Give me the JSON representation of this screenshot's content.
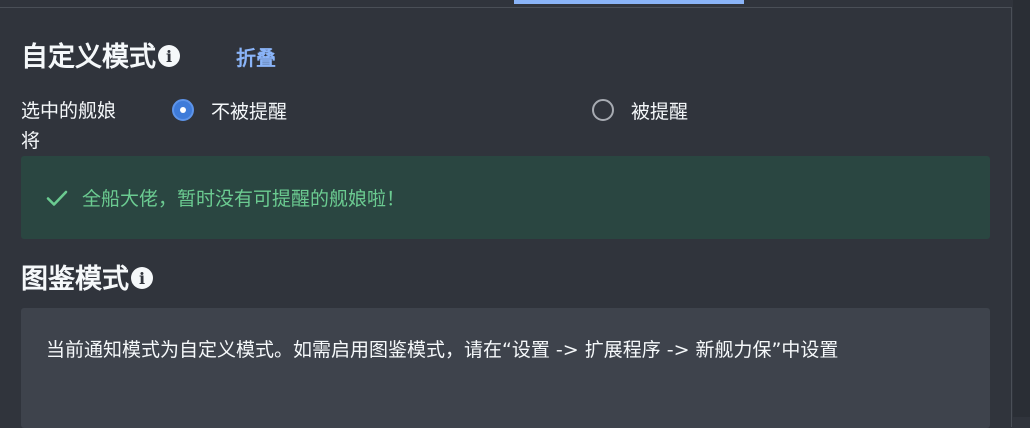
{
  "custom_mode": {
    "title": "自定义模式",
    "info_icon": "info-icon",
    "collapse_label": "折叠"
  },
  "selected_field": {
    "label": "选中的舰娘将",
    "options": [
      {
        "label": "不被提醒",
        "checked": true
      },
      {
        "label": "被提醒",
        "checked": false
      }
    ]
  },
  "success_callout": {
    "icon": "check-icon",
    "text": "全船大佬，暂时没有可提醒的舰娘啦！",
    "color": "#6bcb91"
  },
  "book_mode": {
    "title": "图鉴模式",
    "info_icon": "info-icon",
    "notice": "当前通知模式为自定义模式。如需启用图鉴模式，请在“设置 -> 扩展程序 -> 新舰力保”中设置"
  },
  "colors": {
    "background": "#30343c",
    "accent": "#8ab4f8",
    "radio_checked": "#3e7bd9",
    "success_bg": "#2a4641"
  }
}
